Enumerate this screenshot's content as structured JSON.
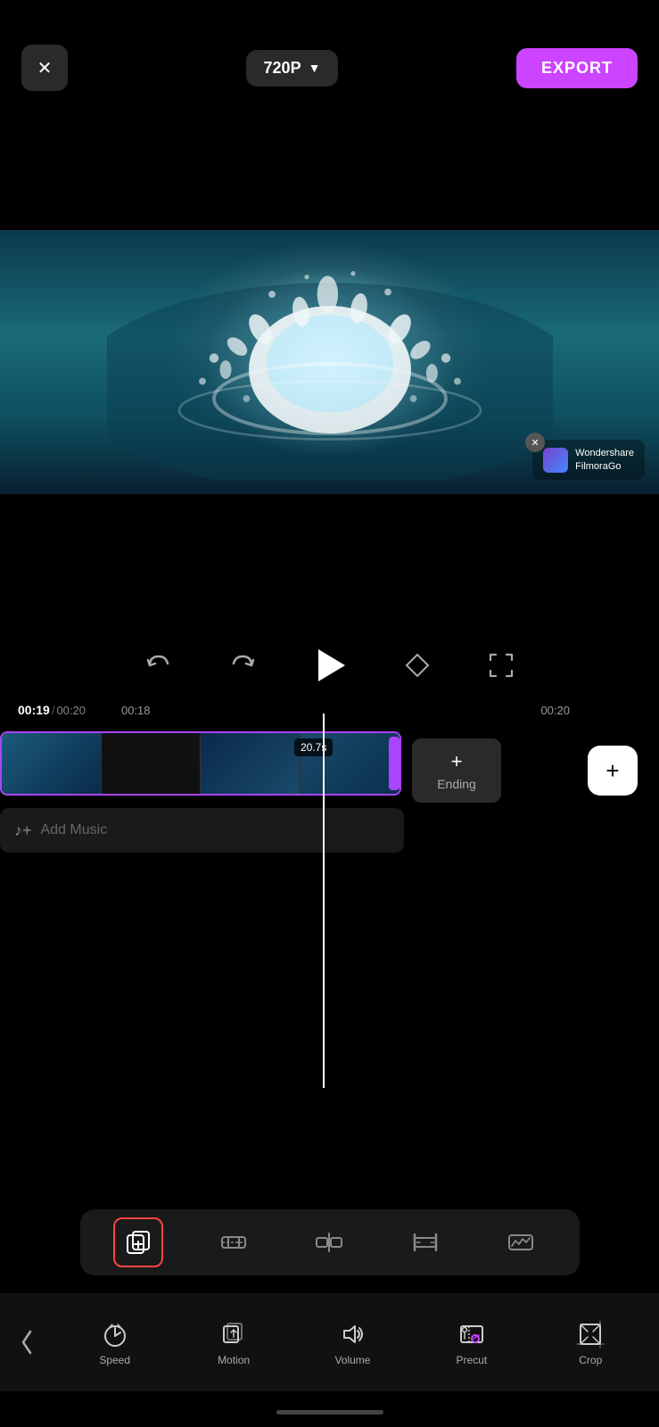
{
  "topBar": {
    "closeLabel": "✕",
    "qualityLabel": "720P",
    "qualityArrow": "▼",
    "exportLabel": "EXPORT"
  },
  "watermark": {
    "closeIcon": "✕",
    "brandName": "Wondershare\nFilmoraGo"
  },
  "controls": {
    "undoIcon": "↺",
    "redoIcon": "↻",
    "playIcon": "▶",
    "diamondIcon": "◇",
    "fullscreenIcon": "⛶"
  },
  "timestamps": {
    "current": "00:19",
    "total": "00:20",
    "mid": "00:18",
    "right": "00:20"
  },
  "timeline": {
    "clipDuration": "20.7s",
    "endingLabel": "Ending",
    "addClipIcon": "+",
    "addMusicLabel": "Add Music"
  },
  "toolbar": {
    "icons": [
      "copy",
      "trim",
      "split",
      "extend",
      "keyframe"
    ]
  },
  "bottomNav": {
    "backIcon": "‹",
    "items": [
      {
        "label": "Speed",
        "icon": "speed"
      },
      {
        "label": "Motion",
        "icon": "motion"
      },
      {
        "label": "Volume",
        "icon": "volume"
      },
      {
        "label": "Precut",
        "icon": "precut"
      },
      {
        "label": "Crop",
        "icon": "crop"
      }
    ]
  }
}
